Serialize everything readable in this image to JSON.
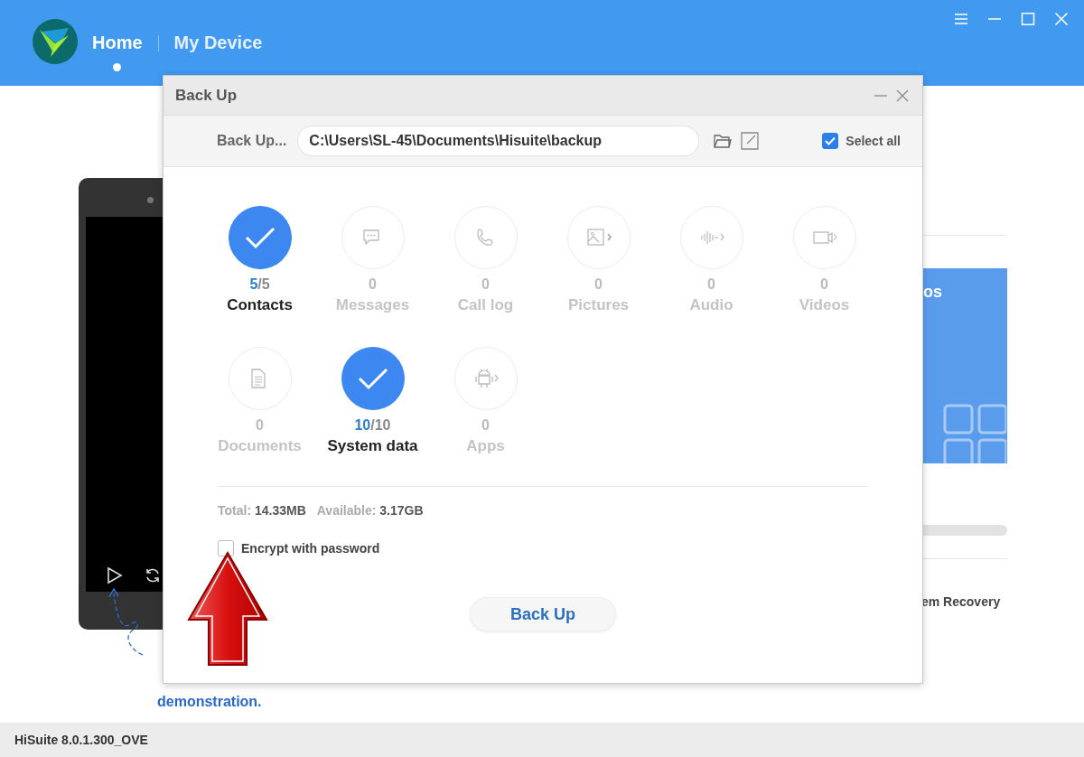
{
  "header": {
    "tabs": [
      {
        "label": "Home",
        "selected": true
      },
      {
        "label": "My Device",
        "selected": false
      }
    ]
  },
  "phone_hint": {
    "lines": [
      "demonstration."
    ]
  },
  "side_panel": {
    "card_title": "os",
    "recovery_label": "em Recovery"
  },
  "dialog": {
    "title": "Back Up",
    "path_label": "Back Up...",
    "path": "C:\\Users\\SL-45\\Documents\\Hisuite\\backup",
    "select_all": {
      "label": "Select all",
      "checked": true
    },
    "categories": [
      {
        "label": "Contacts",
        "selected": true,
        "count": "5",
        "total": "/5"
      },
      {
        "label": "Messages",
        "selected": false,
        "count": "0",
        "kind": "messages"
      },
      {
        "label": "Call log",
        "selected": false,
        "count": "0",
        "kind": "call"
      },
      {
        "label": "Pictures",
        "selected": false,
        "count": "0",
        "kind": "pictures"
      },
      {
        "label": "Audio",
        "selected": false,
        "count": "0",
        "kind": "audio"
      },
      {
        "label": "Videos",
        "selected": false,
        "count": "0",
        "kind": "videos"
      },
      {
        "label": "Documents",
        "selected": false,
        "count": "0",
        "kind": "documents"
      },
      {
        "label": "System data",
        "selected": true,
        "count": "10",
        "total": "/10"
      },
      {
        "label": "Apps",
        "selected": false,
        "count": "0",
        "kind": "apps"
      }
    ],
    "totals": [
      {
        "label": "Total:",
        "value": "14.33MB"
      },
      {
        "label": "Available:",
        "value": "3.17GB"
      }
    ],
    "encrypt": {
      "label": "Encrypt with password",
      "checked": false
    },
    "button": "Back Up"
  },
  "status_bar": "HiSuite 8.0.1.300_OVE"
}
